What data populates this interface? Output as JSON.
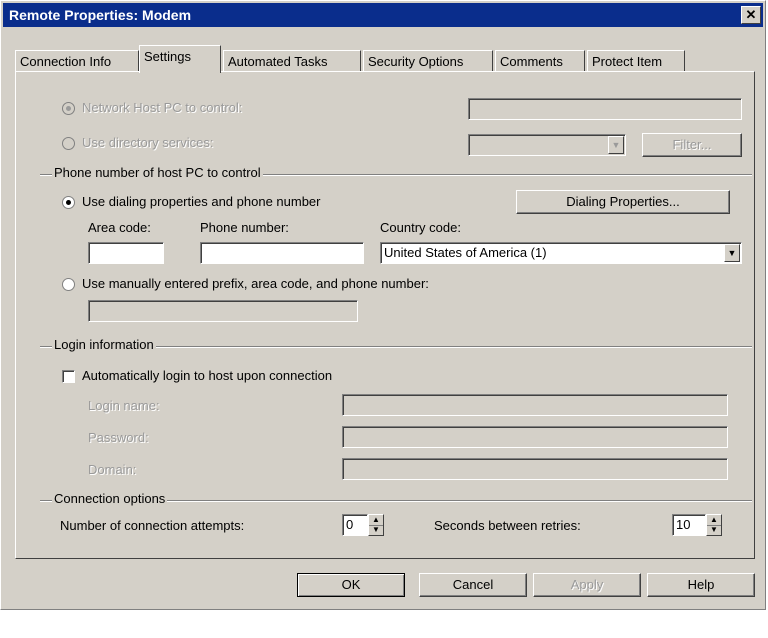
{
  "window": {
    "title": "Remote Properties: Modem",
    "close_glyph": "✕"
  },
  "tabs": [
    {
      "label": "Connection Info"
    },
    {
      "label": "Settings"
    },
    {
      "label": "Automated Tasks"
    },
    {
      "label": "Security Options"
    },
    {
      "label": "Comments"
    },
    {
      "label": "Protect Item"
    }
  ],
  "active_tab": "Settings",
  "host": {
    "network_host_label": "Network Host PC to control:",
    "network_host_value": "",
    "directory_label": "Use directory services:",
    "directory_value": "",
    "filter_button": "Filter..."
  },
  "phone": {
    "group_title": "Phone number of host PC to control",
    "use_dialing_label": "Use dialing properties and phone number",
    "dialing_properties_button": "Dialing Properties...",
    "area_code_label": "Area code:",
    "area_code_value": "",
    "phone_number_label": "Phone number:",
    "phone_number_value": "",
    "country_code_label": "Country code:",
    "country_code_value": "United States of America (1)",
    "manual_label": "Use manually entered prefix, area code, and phone number:",
    "manual_value": ""
  },
  "login": {
    "group_title": "Login information",
    "auto_login_label": "Automatically login to host upon connection",
    "login_name_label": "Login name:",
    "password_label": "Password:",
    "domain_label": "Domain:"
  },
  "connection": {
    "group_title": "Connection options",
    "attempts_label": "Number of connection attempts:",
    "attempts_value": "0",
    "retries_label": "Seconds between retries:",
    "retries_value": "10"
  },
  "buttons": {
    "ok": "OK",
    "cancel": "Cancel",
    "apply": "Apply",
    "help": "Help"
  },
  "colors": {
    "titlebar": "#0a2d8c",
    "face": "#d4d0c8"
  }
}
